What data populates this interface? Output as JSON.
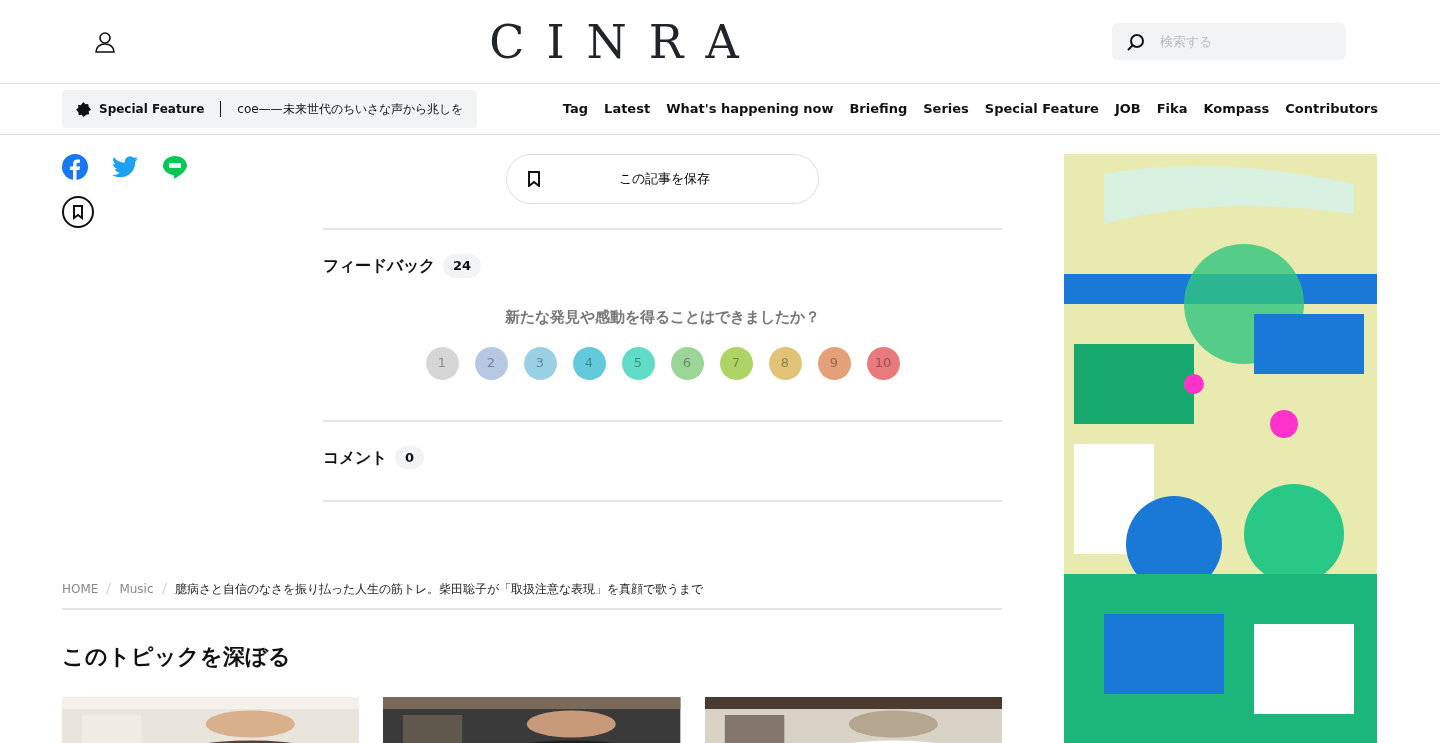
{
  "header": {
    "logo": "CINRA",
    "search": {
      "placeholder": "検索する"
    }
  },
  "ticker": {
    "label": "Special Feature",
    "text": "coe——未来世代のちいさな声から兆しを"
  },
  "nav": [
    "Tag",
    "Latest",
    "What's happening now",
    "Briefing",
    "Series",
    "Special Feature",
    "JOB",
    "Fika",
    "Kompass",
    "Contributors"
  ],
  "save_button": "この記事を保存",
  "feedback": {
    "title": "フィードバック",
    "count": "24",
    "question": "新たな発見や感動を得ることはできましたか？",
    "ratings": [
      {
        "label": "1",
        "color": "#d6d6d6"
      },
      {
        "label": "2",
        "color": "#b8c8e4"
      },
      {
        "label": "3",
        "color": "#9ad0e4"
      },
      {
        "label": "4",
        "color": "#62cadb"
      },
      {
        "label": "5",
        "color": "#60dbc6"
      },
      {
        "label": "6",
        "color": "#9bd597"
      },
      {
        "label": "7",
        "color": "#afd466"
      },
      {
        "label": "8",
        "color": "#e0c376"
      },
      {
        "label": "9",
        "color": "#e5a07a"
      },
      {
        "label": "10",
        "color": "#e87a7b"
      }
    ]
  },
  "comments": {
    "title": "コメント",
    "count": "0"
  },
  "breadcrumb": [
    {
      "label": "HOME",
      "kind": "link"
    },
    {
      "label": "Music",
      "kind": "link"
    },
    {
      "label": "臆病さと自信のなさを振り払った人生の筋トレ。柴田聡子が「取扱注意な表現」を真顔で歌うまで",
      "kind": "current"
    }
  ],
  "topic_heading": "このトピックを深ぼる"
}
